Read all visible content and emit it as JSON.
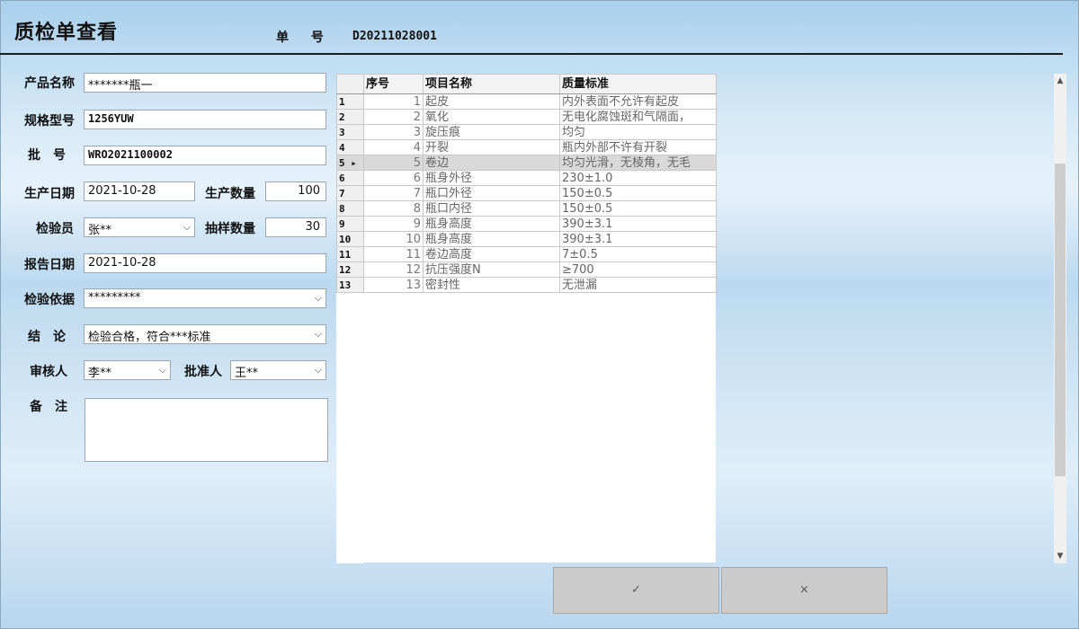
{
  "header": {
    "title": "质检单查看",
    "order_no_label": "单 号",
    "order_no_value": "D20211028001"
  },
  "form": {
    "product_name": {
      "label": "产品名称",
      "value": "*******瓶一"
    },
    "spec_model": {
      "label": "规格型号",
      "value": "1256YUW"
    },
    "batch_no": {
      "label": "批　号",
      "value": "WRO2021100002"
    },
    "production_date": {
      "label": "生产日期",
      "value": "2021-10-28"
    },
    "production_qty": {
      "label": "生产数量",
      "value": "100"
    },
    "inspector": {
      "label": "检验员",
      "value": "张**"
    },
    "sample_qty": {
      "label": "抽样数量",
      "value": "30"
    },
    "report_date": {
      "label": "报告日期",
      "value": "2021-10-28"
    },
    "basis": {
      "label": "检验依据",
      "value": "*********"
    },
    "conclusion": {
      "label": "结　论",
      "value": "检验合格，符合***标准"
    },
    "reviewer": {
      "label": "审核人",
      "value": "李**"
    },
    "approver": {
      "label": "批准人",
      "value": "王**"
    },
    "remark": {
      "label": "备　注",
      "value": ""
    }
  },
  "grid": {
    "columns": [
      "序号",
      "项目名称",
      "质量标准"
    ],
    "selected_row": 5,
    "rows": [
      {
        "rh": "1",
        "no": "1",
        "name": "起皮",
        "standard": "内外表面不允许有起皮"
      },
      {
        "rh": "2",
        "no": "2",
        "name": "氧化",
        "standard": "无电化腐蚀斑和气隔面，"
      },
      {
        "rh": "3",
        "no": "3",
        "name": "旋压痕",
        "standard": "均匀"
      },
      {
        "rh": "4",
        "no": "4",
        "name": "开裂",
        "standard": "瓶内外部不许有开裂"
      },
      {
        "rh": "5 ▸",
        "no": "5",
        "name": "卷边",
        "standard": "均匀光滑，无棱角，无毛"
      },
      {
        "rh": "6",
        "no": "6",
        "name": "瓶身外径",
        "standard": "230±1.0"
      },
      {
        "rh": "7",
        "no": "7",
        "name": "瓶口外径",
        "standard": "150±0.5"
      },
      {
        "rh": "8",
        "no": "8",
        "name": "瓶口内径",
        "standard": "150±0.5"
      },
      {
        "rh": "9",
        "no": "9",
        "name": "瓶身高度",
        "standard": "390±3.1"
      },
      {
        "rh": "10",
        "no": "10",
        "name": "瓶身高度",
        "standard": "390±3.1"
      },
      {
        "rh": "11",
        "no": "11",
        "name": "卷边高度",
        "standard": "7±0.5"
      },
      {
        "rh": "12",
        "no": "12",
        "name": "抗压强度N",
        "standard": "≥700"
      },
      {
        "rh": "13",
        "no": "13",
        "name": "密封性",
        "standard": "无泄漏"
      }
    ]
  },
  "buttons": {
    "confirm": "✓",
    "cancel": "×"
  },
  "scrollbar": {
    "up": "▲",
    "down": "▼"
  },
  "icons": {
    "dropdown": "chevron-down-icon",
    "confirm": "check-icon",
    "cancel": "close-icon"
  }
}
